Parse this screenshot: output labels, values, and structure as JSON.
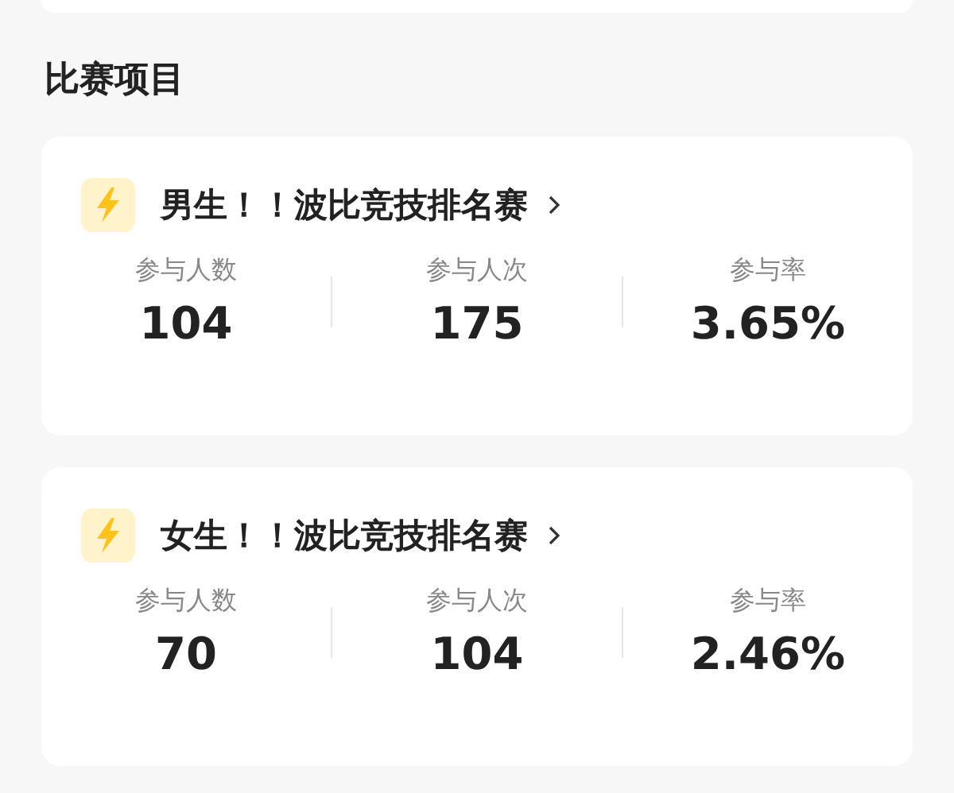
{
  "section_title": "比赛项目",
  "events": [
    {
      "title": "男生！！波比竞技排名赛",
      "stats": [
        {
          "label": "参与人数",
          "value": "104"
        },
        {
          "label": "参与人次",
          "value": "175"
        },
        {
          "label": "参与率",
          "value": "3.65%"
        }
      ]
    },
    {
      "title": "女生！！波比竞技排名赛",
      "stats": [
        {
          "label": "参与人数",
          "value": "70"
        },
        {
          "label": "参与人次",
          "value": "104"
        },
        {
          "label": "参与率",
          "value": "2.46%"
        }
      ]
    }
  ]
}
